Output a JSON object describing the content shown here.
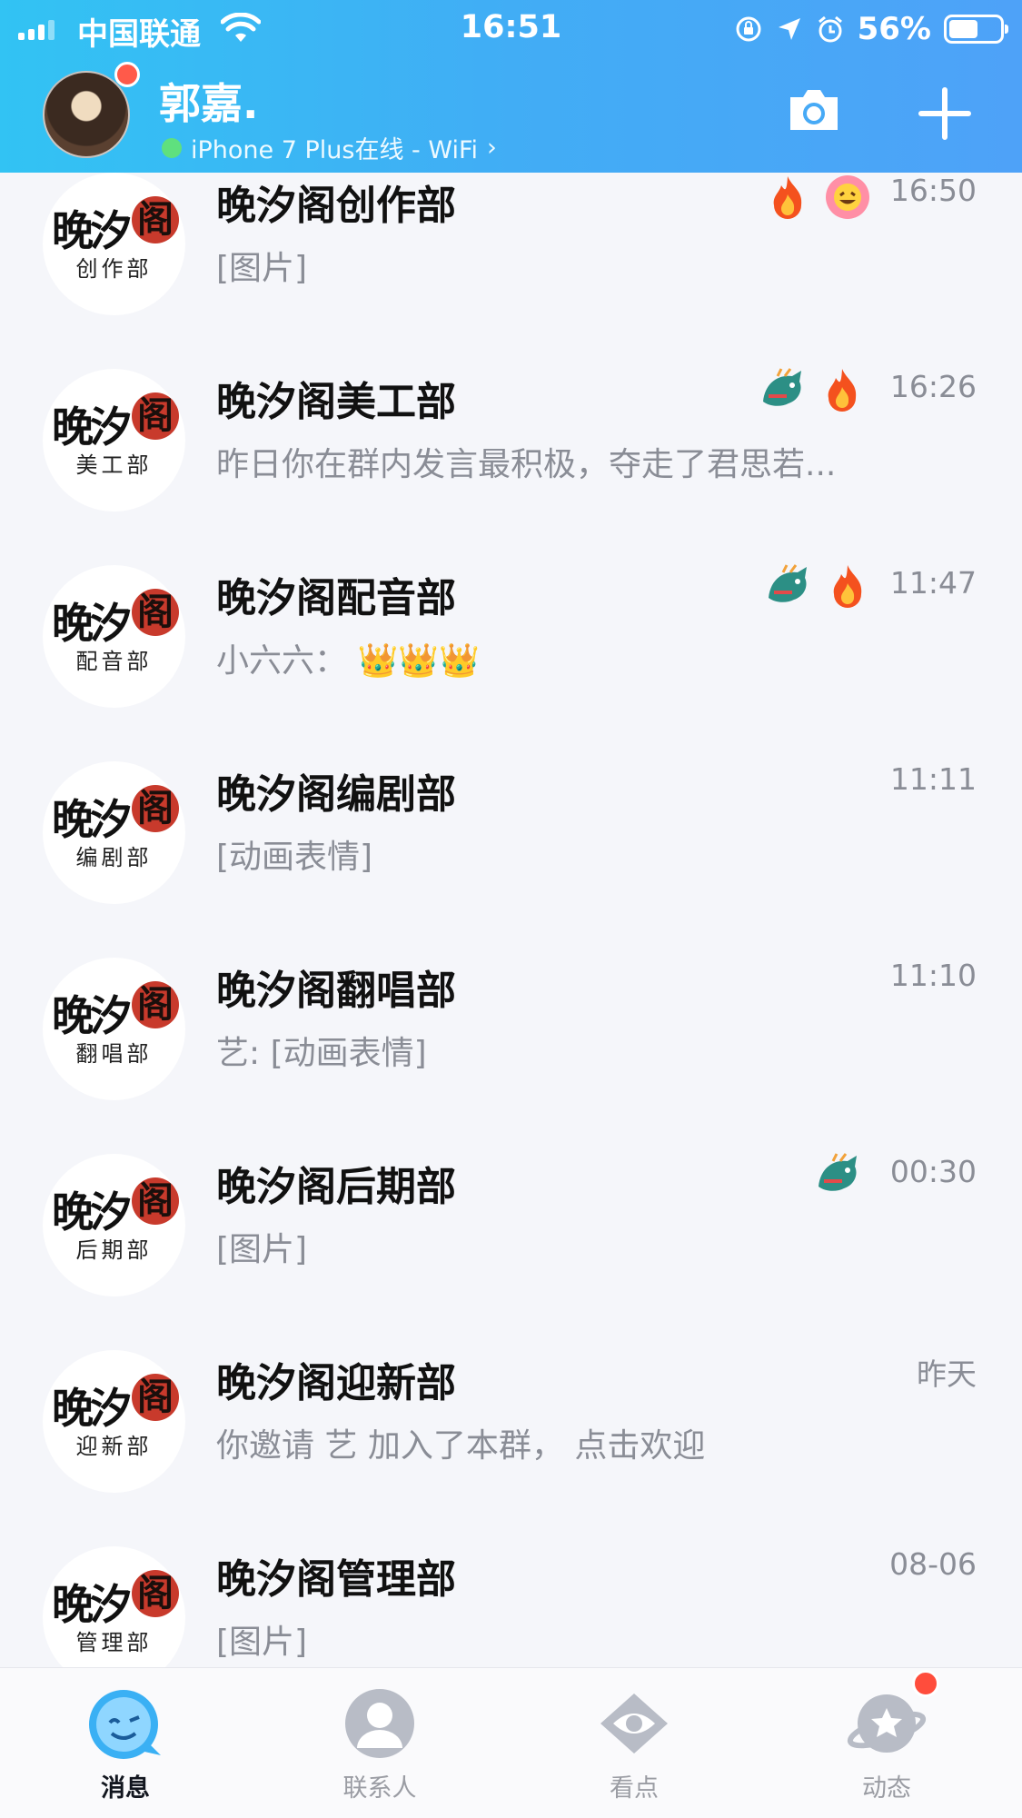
{
  "status_bar": {
    "carrier": "中国联通",
    "time": "16:51",
    "battery": "56%"
  },
  "header": {
    "username": "郭嘉.",
    "device_status": "iPhone 7 Plus在线 - WiFi",
    "chevron": "›"
  },
  "chats": [
    {
      "name": "晚汐阁创作部",
      "avatar_sub": "创作部",
      "message": "[图片]",
      "time": "16:50",
      "badges": [
        "fire-icon",
        "flower-smile-icon"
      ]
    },
    {
      "name": "晚汐阁美工部",
      "avatar_sub": "美工部",
      "message": "昨日你在群内发言最积极，夺走了君思若...",
      "time": "16:26",
      "badges": [
        "dragon-icon",
        "fire-icon"
      ]
    },
    {
      "name": "晚汐阁配音部",
      "avatar_sub": "配音部",
      "message": "小六六： 👑👑👑",
      "time": "11:47",
      "badges": [
        "dragon-icon",
        "fire-icon"
      ]
    },
    {
      "name": "晚汐阁编剧部",
      "avatar_sub": "编剧部",
      "message": "[动画表情]",
      "time": "11:11",
      "badges": []
    },
    {
      "name": "晚汐阁翻唱部",
      "avatar_sub": "翻唱部",
      "message": "艺: [动画表情]",
      "time": "11:10",
      "badges": []
    },
    {
      "name": "晚汐阁后期部",
      "avatar_sub": "后期部",
      "message": "[图片]",
      "time": "00:30",
      "badges": [
        "dragon-icon"
      ]
    },
    {
      "name": "晚汐阁迎新部",
      "avatar_sub": "迎新部",
      "message": "你邀请 艺 加入了本群， 点击欢迎",
      "time": "昨天",
      "badges": []
    },
    {
      "name": "晚汐阁管理部",
      "avatar_sub": "管理部",
      "message": "[图片]",
      "time": "08-06",
      "badges": []
    }
  ],
  "avatar_text": {
    "main": "晚汐",
    "seal": "阁"
  },
  "tabs": [
    {
      "label": "消息",
      "icon": "penguin-icon",
      "active": true
    },
    {
      "label": "联系人",
      "icon": "person-icon",
      "active": false
    },
    {
      "label": "看点",
      "icon": "eye-icon",
      "active": false
    },
    {
      "label": "动态",
      "icon": "planet-star-icon",
      "active": false
    }
  ],
  "colors": {
    "header_start": "#32c3f3",
    "header_end": "#4ea2f8",
    "unread_dot": "#ff4d3c",
    "muted_text": "#8a8d96"
  }
}
